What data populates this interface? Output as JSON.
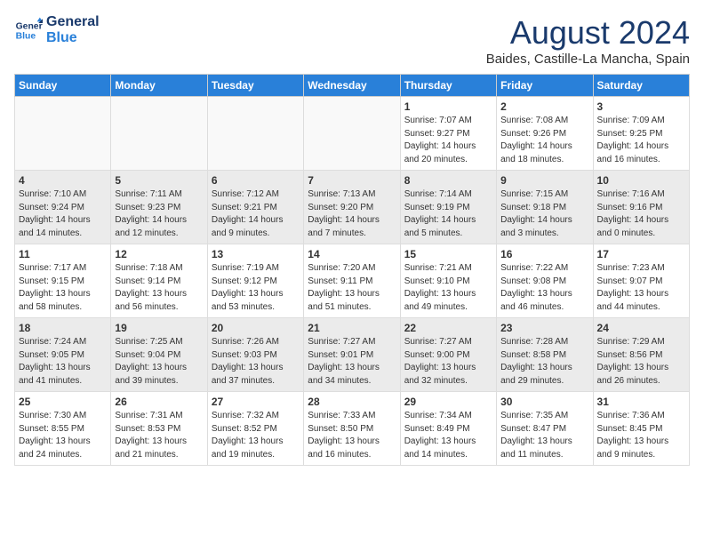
{
  "logo": {
    "line1": "General",
    "line2": "Blue"
  },
  "title": "August 2024",
  "subtitle": "Baides, Castille-La Mancha, Spain",
  "weekdays": [
    "Sunday",
    "Monday",
    "Tuesday",
    "Wednesday",
    "Thursday",
    "Friday",
    "Saturday"
  ],
  "weeks": [
    [
      {
        "day": "",
        "info": ""
      },
      {
        "day": "",
        "info": ""
      },
      {
        "day": "",
        "info": ""
      },
      {
        "day": "",
        "info": ""
      },
      {
        "day": "1",
        "info": "Sunrise: 7:07 AM\nSunset: 9:27 PM\nDaylight: 14 hours\nand 20 minutes."
      },
      {
        "day": "2",
        "info": "Sunrise: 7:08 AM\nSunset: 9:26 PM\nDaylight: 14 hours\nand 18 minutes."
      },
      {
        "day": "3",
        "info": "Sunrise: 7:09 AM\nSunset: 9:25 PM\nDaylight: 14 hours\nand 16 minutes."
      }
    ],
    [
      {
        "day": "4",
        "info": "Sunrise: 7:10 AM\nSunset: 9:24 PM\nDaylight: 14 hours\nand 14 minutes."
      },
      {
        "day": "5",
        "info": "Sunrise: 7:11 AM\nSunset: 9:23 PM\nDaylight: 14 hours\nand 12 minutes."
      },
      {
        "day": "6",
        "info": "Sunrise: 7:12 AM\nSunset: 9:21 PM\nDaylight: 14 hours\nand 9 minutes."
      },
      {
        "day": "7",
        "info": "Sunrise: 7:13 AM\nSunset: 9:20 PM\nDaylight: 14 hours\nand 7 minutes."
      },
      {
        "day": "8",
        "info": "Sunrise: 7:14 AM\nSunset: 9:19 PM\nDaylight: 14 hours\nand 5 minutes."
      },
      {
        "day": "9",
        "info": "Sunrise: 7:15 AM\nSunset: 9:18 PM\nDaylight: 14 hours\nand 3 minutes."
      },
      {
        "day": "10",
        "info": "Sunrise: 7:16 AM\nSunset: 9:16 PM\nDaylight: 14 hours\nand 0 minutes."
      }
    ],
    [
      {
        "day": "11",
        "info": "Sunrise: 7:17 AM\nSunset: 9:15 PM\nDaylight: 13 hours\nand 58 minutes."
      },
      {
        "day": "12",
        "info": "Sunrise: 7:18 AM\nSunset: 9:14 PM\nDaylight: 13 hours\nand 56 minutes."
      },
      {
        "day": "13",
        "info": "Sunrise: 7:19 AM\nSunset: 9:12 PM\nDaylight: 13 hours\nand 53 minutes."
      },
      {
        "day": "14",
        "info": "Sunrise: 7:20 AM\nSunset: 9:11 PM\nDaylight: 13 hours\nand 51 minutes."
      },
      {
        "day": "15",
        "info": "Sunrise: 7:21 AM\nSunset: 9:10 PM\nDaylight: 13 hours\nand 49 minutes."
      },
      {
        "day": "16",
        "info": "Sunrise: 7:22 AM\nSunset: 9:08 PM\nDaylight: 13 hours\nand 46 minutes."
      },
      {
        "day": "17",
        "info": "Sunrise: 7:23 AM\nSunset: 9:07 PM\nDaylight: 13 hours\nand 44 minutes."
      }
    ],
    [
      {
        "day": "18",
        "info": "Sunrise: 7:24 AM\nSunset: 9:05 PM\nDaylight: 13 hours\nand 41 minutes."
      },
      {
        "day": "19",
        "info": "Sunrise: 7:25 AM\nSunset: 9:04 PM\nDaylight: 13 hours\nand 39 minutes."
      },
      {
        "day": "20",
        "info": "Sunrise: 7:26 AM\nSunset: 9:03 PM\nDaylight: 13 hours\nand 37 minutes."
      },
      {
        "day": "21",
        "info": "Sunrise: 7:27 AM\nSunset: 9:01 PM\nDaylight: 13 hours\nand 34 minutes."
      },
      {
        "day": "22",
        "info": "Sunrise: 7:27 AM\nSunset: 9:00 PM\nDaylight: 13 hours\nand 32 minutes."
      },
      {
        "day": "23",
        "info": "Sunrise: 7:28 AM\nSunset: 8:58 PM\nDaylight: 13 hours\nand 29 minutes."
      },
      {
        "day": "24",
        "info": "Sunrise: 7:29 AM\nSunset: 8:56 PM\nDaylight: 13 hours\nand 26 minutes."
      }
    ],
    [
      {
        "day": "25",
        "info": "Sunrise: 7:30 AM\nSunset: 8:55 PM\nDaylight: 13 hours\nand 24 minutes."
      },
      {
        "day": "26",
        "info": "Sunrise: 7:31 AM\nSunset: 8:53 PM\nDaylight: 13 hours\nand 21 minutes."
      },
      {
        "day": "27",
        "info": "Sunrise: 7:32 AM\nSunset: 8:52 PM\nDaylight: 13 hours\nand 19 minutes."
      },
      {
        "day": "28",
        "info": "Sunrise: 7:33 AM\nSunset: 8:50 PM\nDaylight: 13 hours\nand 16 minutes."
      },
      {
        "day": "29",
        "info": "Sunrise: 7:34 AM\nSunset: 8:49 PM\nDaylight: 13 hours\nand 14 minutes."
      },
      {
        "day": "30",
        "info": "Sunrise: 7:35 AM\nSunset: 8:47 PM\nDaylight: 13 hours\nand 11 minutes."
      },
      {
        "day": "31",
        "info": "Sunrise: 7:36 AM\nSunset: 8:45 PM\nDaylight: 13 hours\nand 9 minutes."
      }
    ]
  ]
}
